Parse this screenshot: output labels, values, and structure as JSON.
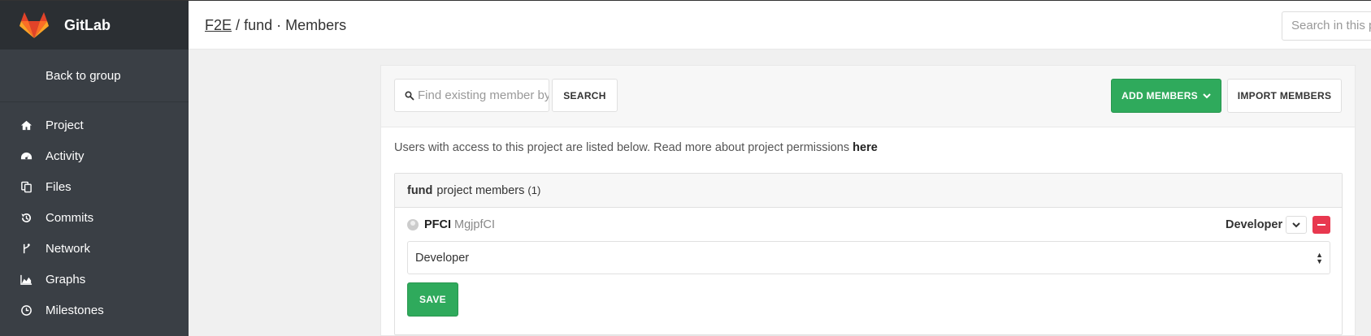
{
  "app": {
    "name": "GitLab"
  },
  "sidebar": {
    "back_label": "Back to group",
    "items": [
      {
        "label": "Project",
        "icon": "home-icon"
      },
      {
        "label": "Activity",
        "icon": "dashboard-icon"
      },
      {
        "label": "Files",
        "icon": "files-icon"
      },
      {
        "label": "Commits",
        "icon": "history-icon"
      },
      {
        "label": "Network",
        "icon": "branch-icon"
      },
      {
        "label": "Graphs",
        "icon": "area-chart-icon"
      },
      {
        "label": "Milestones",
        "icon": "clock-icon"
      }
    ]
  },
  "header": {
    "group": "F2E",
    "separator": "/",
    "project_page": "fund · Members",
    "search_placeholder": "Search in this p"
  },
  "toolbar": {
    "find_placeholder": "Find existing member by",
    "search_label": "SEARCH",
    "add_members_label": "ADD MEMBERS",
    "import_members_label": "IMPORT MEMBERS"
  },
  "info": {
    "text": "Users with access to this project are listed below. Read more about project permissions",
    "link": "here"
  },
  "members_panel": {
    "project": "fund",
    "title": "project members",
    "count": "(1)",
    "member": {
      "name": "PFCI",
      "username": "MgjpfCI",
      "role": "Developer"
    },
    "role_select_value": "Developer",
    "save_label": "SAVE"
  },
  "colors": {
    "sidebar_bg": "#3a3f45",
    "brand_bg": "#2b2f33",
    "primary_green": "#2faa5c",
    "danger_red": "#e8384f"
  }
}
